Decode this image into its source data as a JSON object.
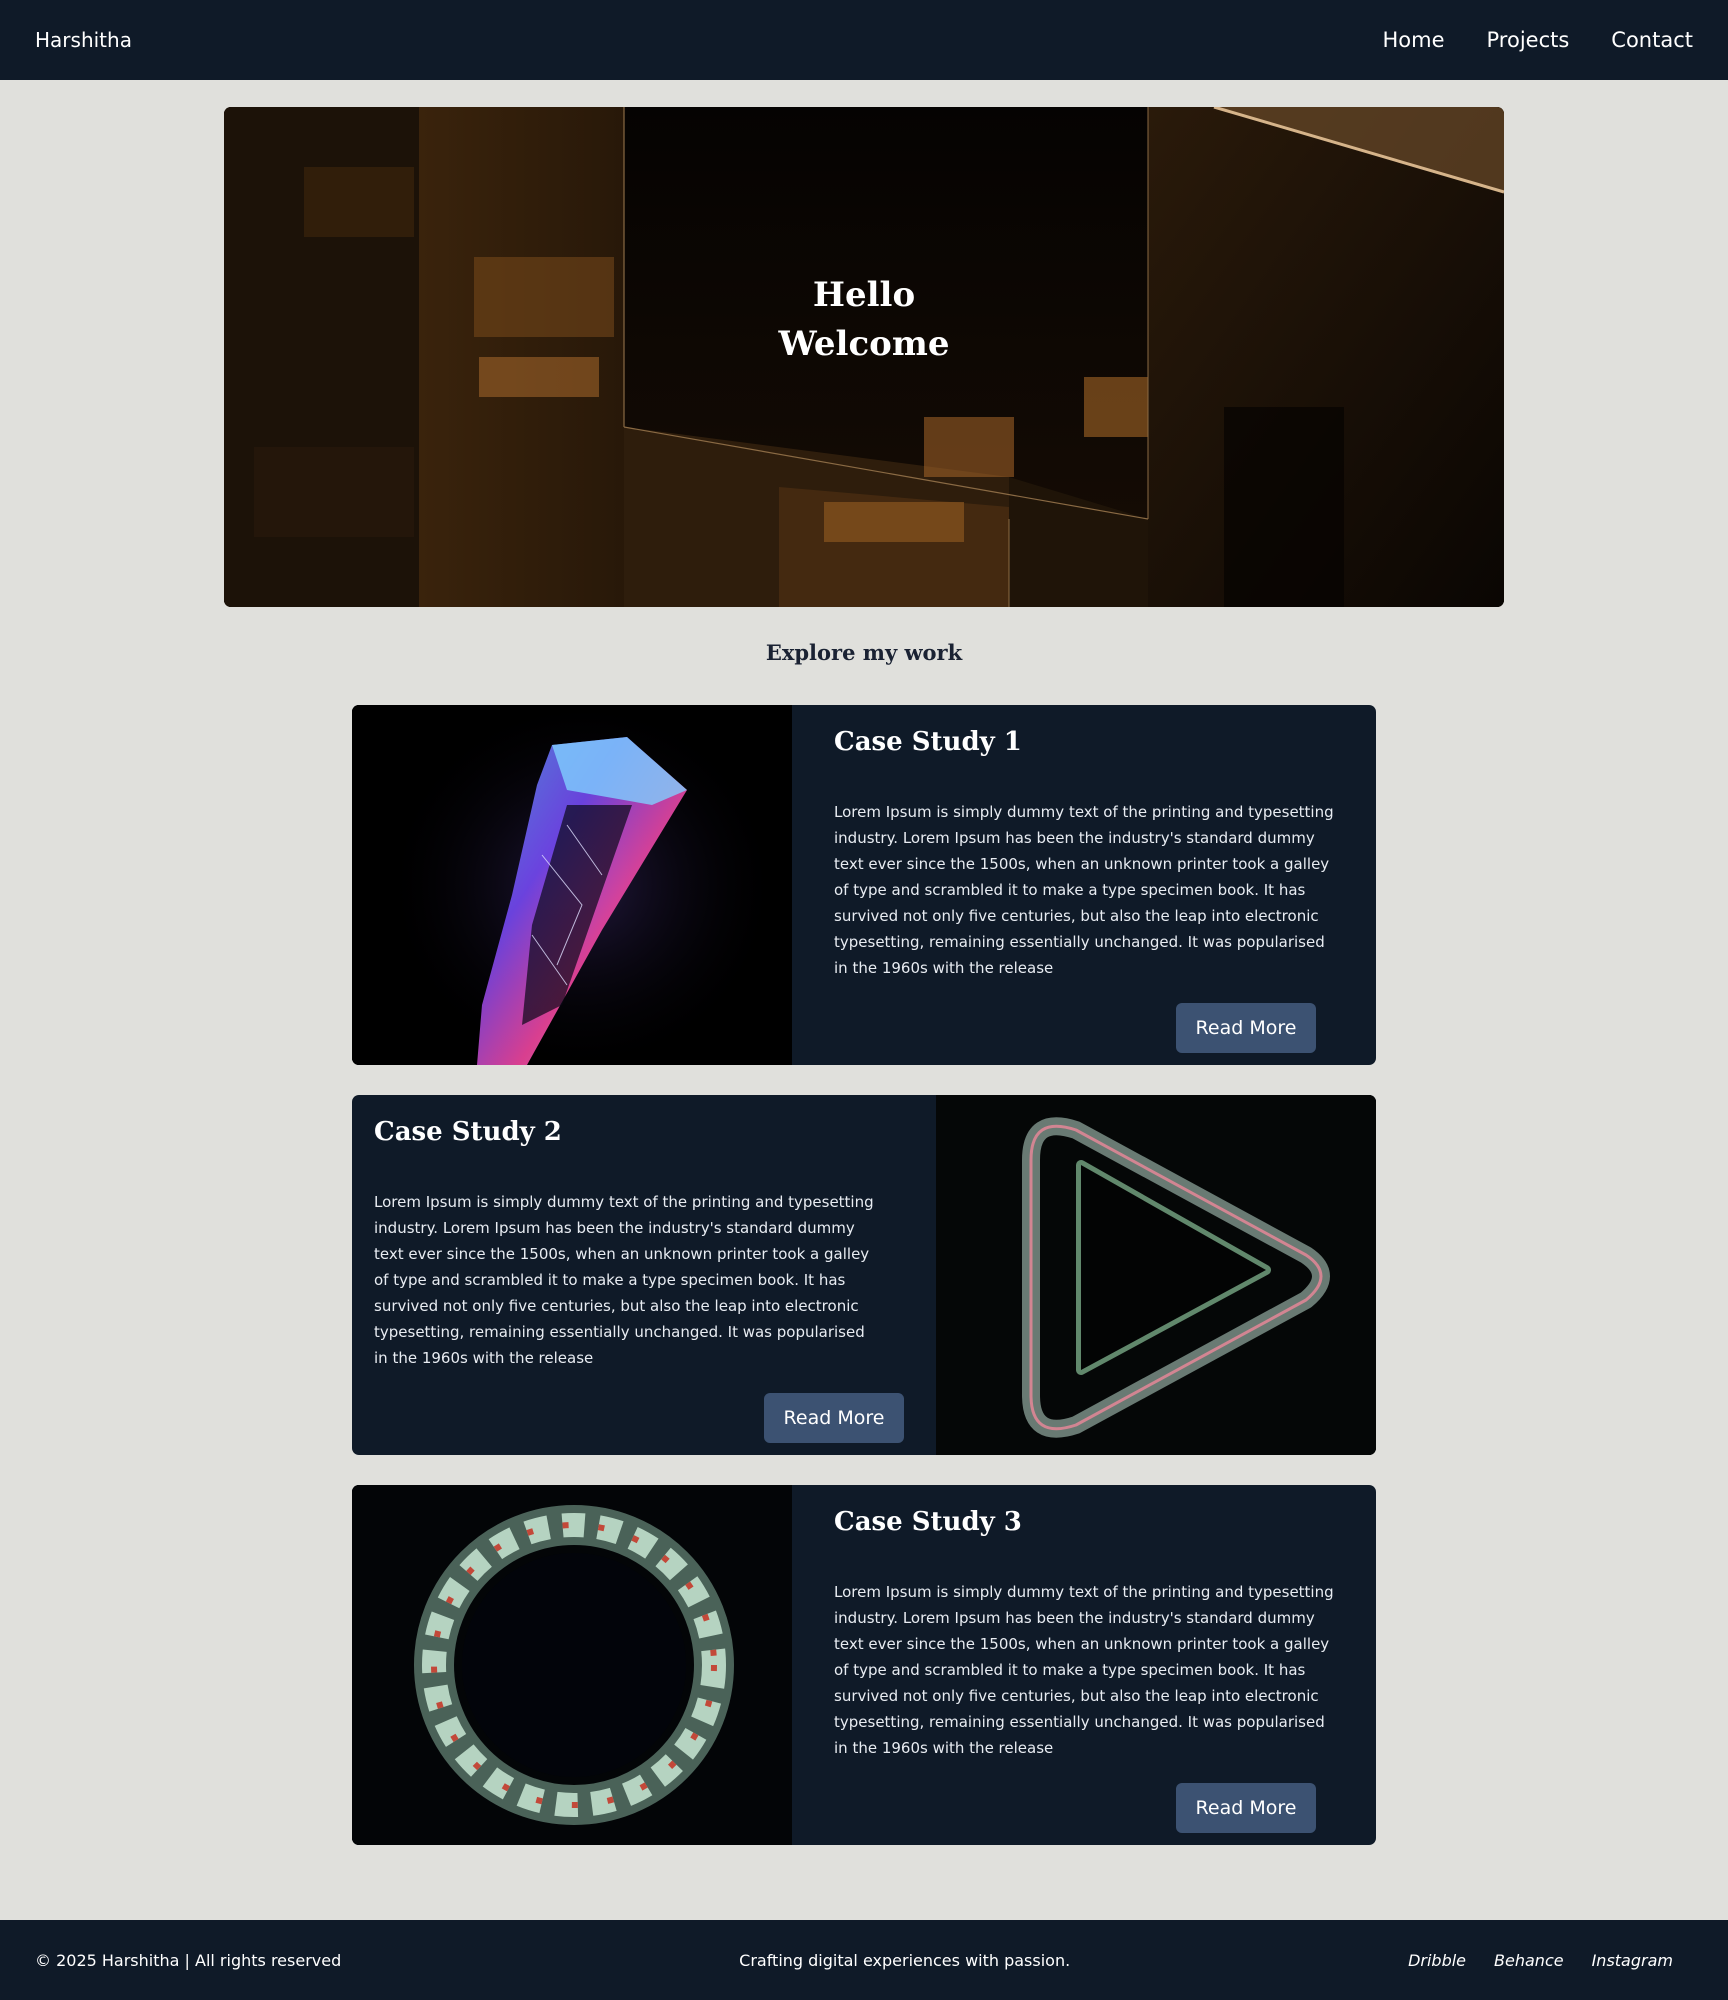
{
  "header": {
    "brand": "Harshitha",
    "nav": [
      "Home",
      "Projects",
      "Contact"
    ]
  },
  "hero": {
    "line1": "Hello",
    "line2": "Welcome"
  },
  "section_title": "Explore my work",
  "cases": [
    {
      "title": "Case Study 1",
      "text": "Lorem Ipsum is simply dummy text of the printing and typesetting industry. Lorem Ipsum has been the industry's standard dummy text ever since the 1500s, when an unknown printer took a galley of type and scrambled it to make a type specimen book. It has survived not only five centuries, but also the leap into electronic typesetting, remaining essentially unchanged. It was popularised in the 1960s with the release",
      "button": "Read More"
    },
    {
      "title": "Case Study 2",
      "text": "Lorem Ipsum is simply dummy text of the printing and typesetting industry. Lorem Ipsum has been the industry's standard dummy text ever since the 1500s, when an unknown printer took a galley of type and scrambled it to make a type specimen book. It has survived not only five centuries, but also the leap into electronic typesetting, remaining essentially unchanged. It was popularised in the 1960s with the release",
      "button": "Read More"
    },
    {
      "title": "Case Study 3",
      "text": "Lorem Ipsum is simply dummy text of the printing and typesetting industry. Lorem Ipsum has been the industry's standard dummy text ever since the 1500s, when an unknown printer took a galley of type and scrambled it to make a type specimen book. It has survived not only five centuries, but also the leap into electronic typesetting, remaining essentially unchanged. It was popularised in the 1960s with the release",
      "button": "Read More"
    }
  ],
  "footer": {
    "copyright": "© 2025 Harshitha | All rights reserved",
    "tagline": "Crafting digital experiences with passion.",
    "social": [
      "Dribble",
      "Behance",
      "Instagram"
    ]
  },
  "colors": {
    "navy": "#0f1a28",
    "page_bg": "#e0e0dc",
    "button": "#3c5272"
  }
}
